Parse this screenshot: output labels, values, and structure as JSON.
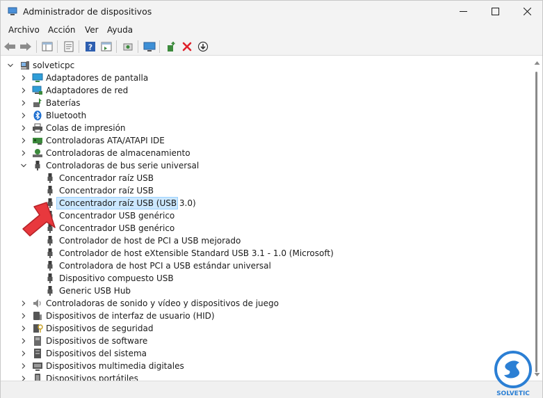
{
  "window": {
    "title": "Administrador de dispositivos"
  },
  "menu": [
    "Archivo",
    "Acción",
    "Ver",
    "Ayuda"
  ],
  "tree": {
    "root": "solveticpc",
    "items": [
      {
        "label": "Adaptadores de pantalla",
        "icon": "monitor-icon",
        "expanded": false
      },
      {
        "label": "Adaptadores de red",
        "icon": "network-icon",
        "expanded": false
      },
      {
        "label": "Baterías",
        "icon": "battery-icon",
        "expanded": false
      },
      {
        "label": "Bluetooth",
        "icon": "bluetooth-icon",
        "expanded": false
      },
      {
        "label": "Colas de impresión",
        "icon": "printer-icon",
        "expanded": false
      },
      {
        "label": "Controladoras ATA/ATAPI IDE",
        "icon": "ide-controller-icon",
        "expanded": false
      },
      {
        "label": "Controladoras de almacenamiento",
        "icon": "storage-icon",
        "expanded": false
      },
      {
        "label": "Controladoras de bus serie universal",
        "icon": "usb-icon",
        "expanded": true,
        "children": [
          "Concentrador raíz USB",
          "Concentrador raíz USB",
          "Concentrador raíz USB (USB 3.0)",
          "Concentrador USB genérico",
          "Concentrador USB genérico",
          "Controlador de host de PCI a USB mejorado",
          "Controlador de host eXtensible Standard USB 3.1 - 1.0 (Microsoft)",
          "Controladora de host PCI a USB estándar universal",
          "Dispositivo compuesto USB",
          "Generic USB Hub"
        ]
      },
      {
        "label": "Controladoras de sonido y vídeo y dispositivos de juego",
        "icon": "speaker-icon",
        "expanded": false
      },
      {
        "label": "Dispositivos de interfaz de usuario (HID)",
        "icon": "hid-icon",
        "expanded": false
      },
      {
        "label": "Dispositivos de seguridad",
        "icon": "security-icon",
        "expanded": false
      },
      {
        "label": "Dispositivos de software",
        "icon": "software-device-icon",
        "expanded": false
      },
      {
        "label": "Dispositivos del sistema",
        "icon": "system-device-icon",
        "expanded": false
      },
      {
        "label": "Dispositivos multimedia digitales",
        "icon": "multimedia-icon",
        "expanded": false
      },
      {
        "label": "Dispositivos portátiles",
        "icon": "portable-device-icon",
        "expanded": false
      }
    ],
    "selected_child": "Concentrador raíz USB (USB 3.0)"
  },
  "watermark": {
    "text": "SOLVETIC"
  },
  "colors": {
    "selection": "#cce8ff",
    "selection_border": "#99d1ff",
    "arrow": "#e8383d",
    "accent": "#2b7fd4"
  }
}
